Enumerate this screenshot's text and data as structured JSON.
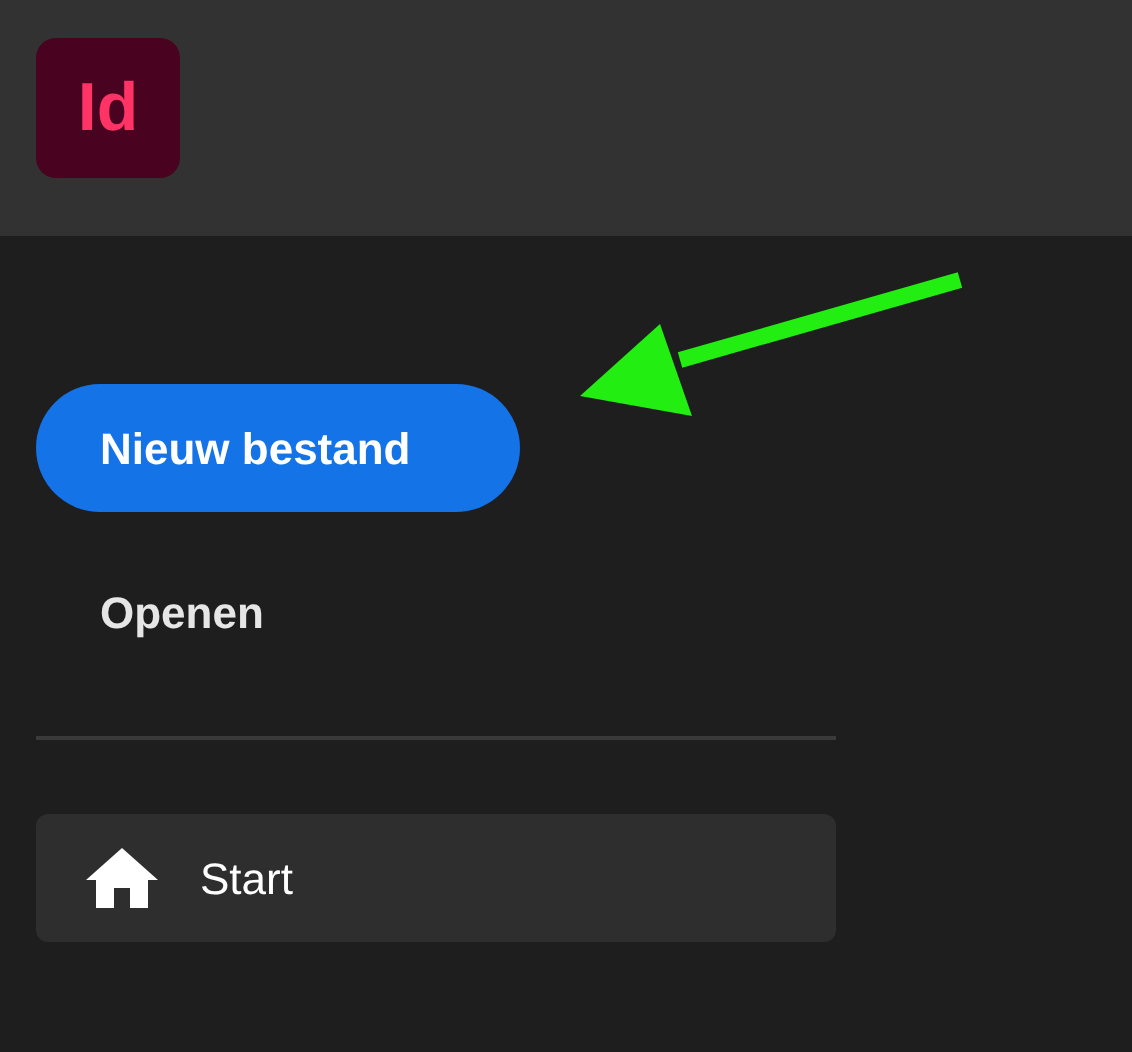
{
  "app_logo": {
    "text": "Id"
  },
  "actions": [
    {
      "label": "Nieuw bestand",
      "kind": "primary"
    },
    {
      "label": "Openen",
      "kind": "plain"
    }
  ],
  "nav": [
    {
      "label": "Start",
      "selected": true
    }
  ]
}
